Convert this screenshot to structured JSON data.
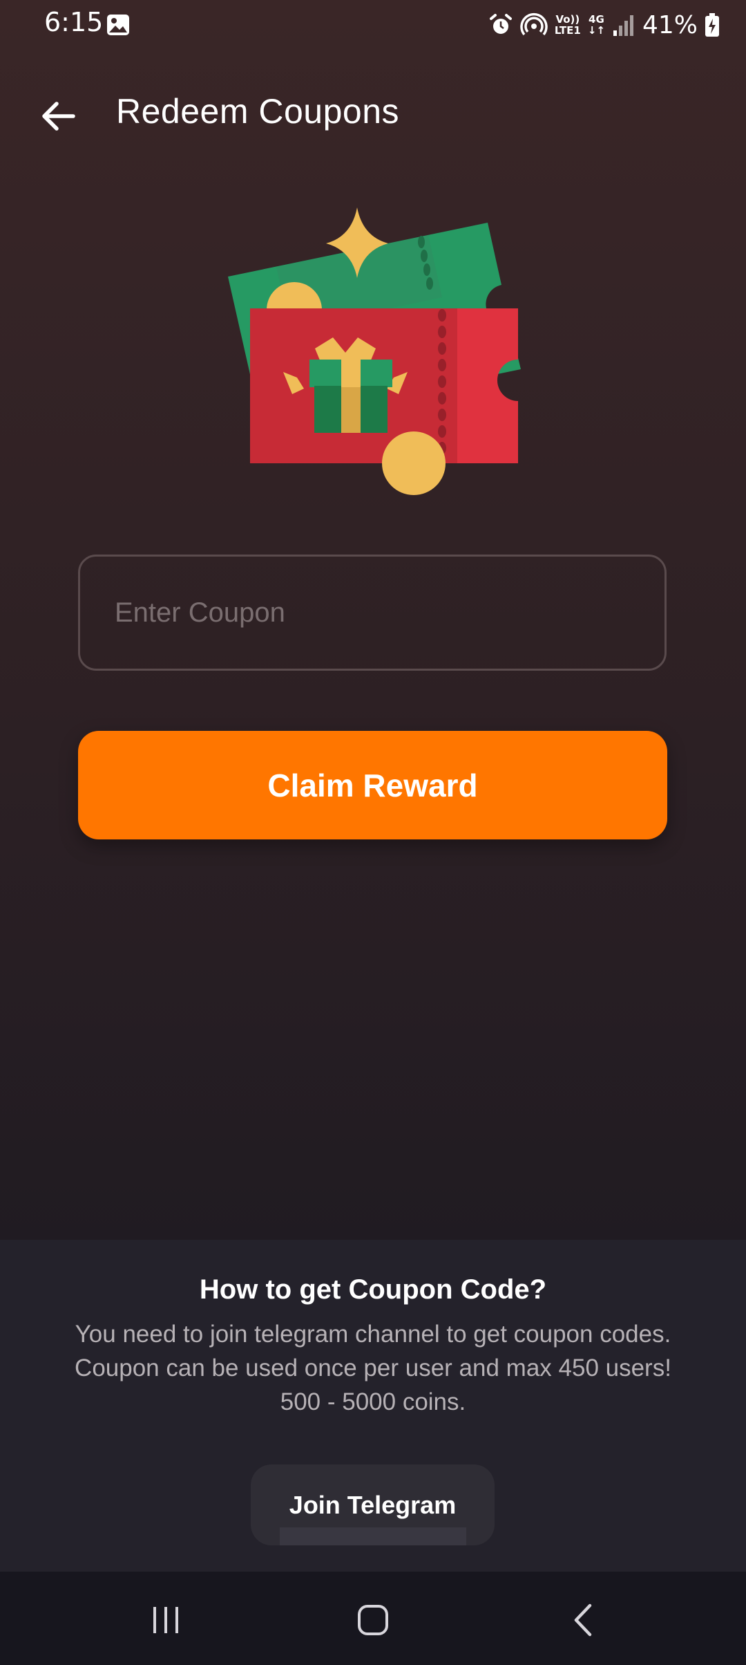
{
  "status_bar": {
    "time": "6:15",
    "volte_line1": "Vo))",
    "volte_line2": "LTE1",
    "network_type": "4G",
    "battery": "41%",
    "icons": [
      "gallery-icon",
      "alarm-icon",
      "hotspot-icon",
      "volte-icon",
      "network-4g-icon",
      "signal-icon",
      "battery-charging-icon"
    ]
  },
  "app_bar": {
    "title": "Redeem Coupons",
    "back_icon": "arrow-left-icon"
  },
  "illustration": {
    "name": "coupon-gift-illustration",
    "colors": {
      "green_ticket": "#269a63",
      "red_ticket": "#e0323f",
      "coin": "#f0bd58",
      "gift_box": "#1d7a48",
      "ribbon": "#e9b24e"
    }
  },
  "form": {
    "coupon_placeholder": "Enter Coupon",
    "coupon_value": "",
    "claim_label": "Claim Reward"
  },
  "info": {
    "title": "How to get Coupon Code?",
    "line1": "You need to join telegram channel to get coupon codes.",
    "line2": "Coupon can be used once per user and max 450 users!",
    "line3": "500 - 5000 coins.",
    "telegram_label": "Join Telegram"
  },
  "nav_bar": {
    "buttons": [
      "recent-apps-icon",
      "home-icon",
      "back-chevron-icon"
    ]
  },
  "colors": {
    "accent": "#ff7600",
    "background_top": "#3a2627",
    "background_bottom": "#1b1a22",
    "panel": "#24222b"
  }
}
